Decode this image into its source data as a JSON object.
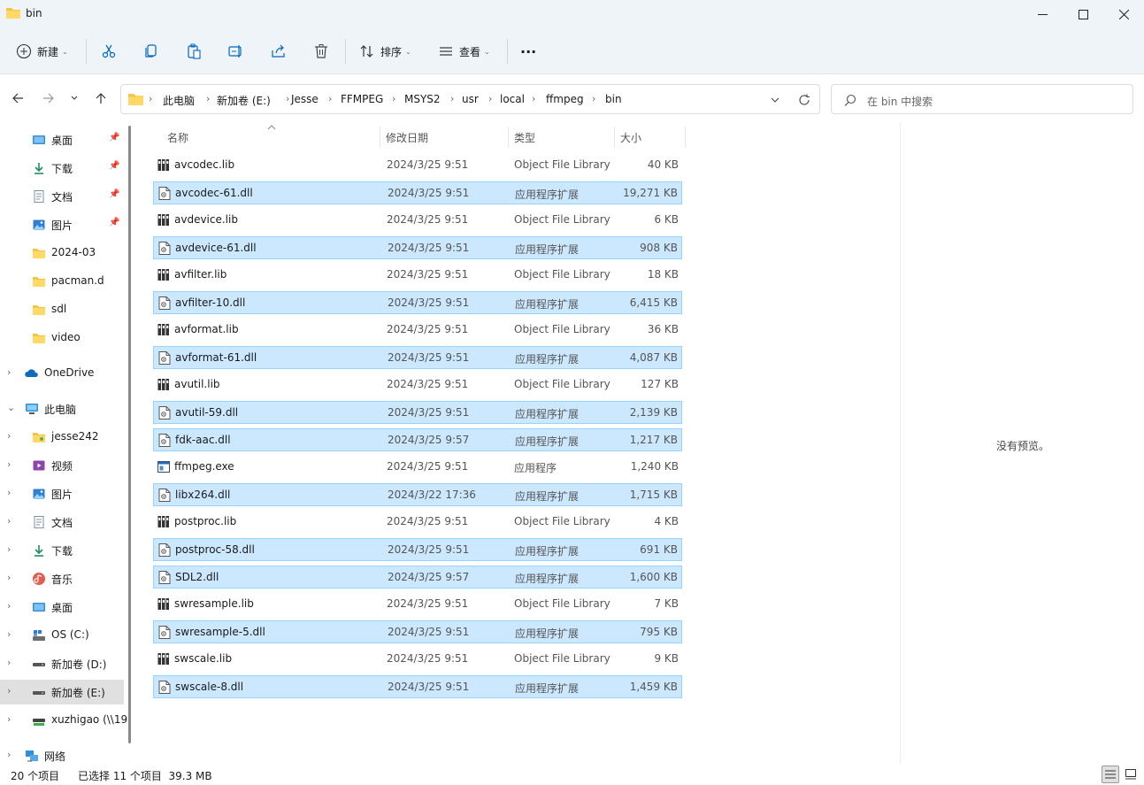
{
  "window": {
    "title": "bin",
    "minimize_label": "─",
    "maximize_label": "☐",
    "close_label": "✕"
  },
  "commandbar": {
    "new_label": "新建",
    "sort_label": "排序",
    "view_label": "查看",
    "more_label": "···"
  },
  "address": {
    "breadcrumbs": [
      "此电脑",
      "新加卷 (E:)",
      "Jesse",
      "FFMPEG",
      "MSYS2",
      "usr",
      "local",
      "ffmpeg",
      "bin"
    ],
    "separator": "›"
  },
  "search": {
    "placeholder": "在 bin 中搜索"
  },
  "nav": {
    "quick": [
      {
        "label": "桌面",
        "icon": "desktop-icon"
      },
      {
        "label": "下载",
        "icon": "download-icon"
      },
      {
        "label": "文档",
        "icon": "document-icon"
      },
      {
        "label": "图片",
        "icon": "picture-icon"
      },
      {
        "label": "2024-03",
        "icon": "folder-icon"
      },
      {
        "label": "pacman.d",
        "icon": "folder-icon"
      },
      {
        "label": "sdl",
        "icon": "folder-icon"
      },
      {
        "label": "video",
        "icon": "folder-icon"
      }
    ],
    "onedrive": "OneDrive",
    "thispc": "此电脑",
    "pc_items": [
      {
        "label": "jesse242",
        "icon": "user-folder-icon"
      },
      {
        "label": "视频",
        "icon": "video-icon"
      },
      {
        "label": "图片",
        "icon": "picture-icon"
      },
      {
        "label": "文档",
        "icon": "document-icon"
      },
      {
        "label": "下载",
        "icon": "download-icon"
      },
      {
        "label": "音乐",
        "icon": "music-icon"
      },
      {
        "label": "桌面",
        "icon": "desktop-icon"
      },
      {
        "label": "OS (C:)",
        "icon": "os-drive-icon"
      },
      {
        "label": "新加卷 (D:)",
        "icon": "drive-icon"
      },
      {
        "label": "新加卷 (E:)",
        "icon": "drive-icon"
      },
      {
        "label": "xuzhigao (\\\\19",
        "icon": "network-drive-icon"
      }
    ],
    "network": "网络"
  },
  "columns": {
    "name": "名称",
    "date": "修改日期",
    "type": "类型",
    "size": "大小"
  },
  "files": [
    {
      "name": "avcodec.lib",
      "date": "2024/3/25 9:51",
      "type": "Object File Library",
      "size": "40 KB",
      "kind": "lib",
      "selected": false
    },
    {
      "name": "avcodec-61.dll",
      "date": "2024/3/25 9:51",
      "type": "应用程序扩展",
      "size": "19,271 KB",
      "kind": "dll",
      "selected": true
    },
    {
      "name": "avdevice.lib",
      "date": "2024/3/25 9:51",
      "type": "Object File Library",
      "size": "6 KB",
      "kind": "lib",
      "selected": false
    },
    {
      "name": "avdevice-61.dll",
      "date": "2024/3/25 9:51",
      "type": "应用程序扩展",
      "size": "908 KB",
      "kind": "dll",
      "selected": true
    },
    {
      "name": "avfilter.lib",
      "date": "2024/3/25 9:51",
      "type": "Object File Library",
      "size": "18 KB",
      "kind": "lib",
      "selected": false
    },
    {
      "name": "avfilter-10.dll",
      "date": "2024/3/25 9:51",
      "type": "应用程序扩展",
      "size": "6,415 KB",
      "kind": "dll",
      "selected": true
    },
    {
      "name": "avformat.lib",
      "date": "2024/3/25 9:51",
      "type": "Object File Library",
      "size": "36 KB",
      "kind": "lib",
      "selected": false
    },
    {
      "name": "avformat-61.dll",
      "date": "2024/3/25 9:51",
      "type": "应用程序扩展",
      "size": "4,087 KB",
      "kind": "dll",
      "selected": true
    },
    {
      "name": "avutil.lib",
      "date": "2024/3/25 9:51",
      "type": "Object File Library",
      "size": "127 KB",
      "kind": "lib",
      "selected": false
    },
    {
      "name": "avutil-59.dll",
      "date": "2024/3/25 9:51",
      "type": "应用程序扩展",
      "size": "2,139 KB",
      "kind": "dll",
      "selected": true
    },
    {
      "name": "fdk-aac.dll",
      "date": "2024/3/25 9:57",
      "type": "应用程序扩展",
      "size": "1,217 KB",
      "kind": "dll",
      "selected": true
    },
    {
      "name": "ffmpeg.exe",
      "date": "2024/3/25 9:51",
      "type": "应用程序",
      "size": "1,240 KB",
      "kind": "exe",
      "selected": false
    },
    {
      "name": "libx264.dll",
      "date": "2024/3/22 17:36",
      "type": "应用程序扩展",
      "size": "1,715 KB",
      "kind": "dll",
      "selected": true
    },
    {
      "name": "postproc.lib",
      "date": "2024/3/25 9:51",
      "type": "Object File Library",
      "size": "4 KB",
      "kind": "lib",
      "selected": false
    },
    {
      "name": "postproc-58.dll",
      "date": "2024/3/25 9:51",
      "type": "应用程序扩展",
      "size": "691 KB",
      "kind": "dll",
      "selected": true
    },
    {
      "name": "SDL2.dll",
      "date": "2024/3/25 9:57",
      "type": "应用程序扩展",
      "size": "1,600 KB",
      "kind": "dll",
      "selected": true
    },
    {
      "name": "swresample.lib",
      "date": "2024/3/25 9:51",
      "type": "Object File Library",
      "size": "7 KB",
      "kind": "lib",
      "selected": false
    },
    {
      "name": "swresample-5.dll",
      "date": "2024/3/25 9:51",
      "type": "应用程序扩展",
      "size": "795 KB",
      "kind": "dll",
      "selected": true
    },
    {
      "name": "swscale.lib",
      "date": "2024/3/25 9:51",
      "type": "Object File Library",
      "size": "9 KB",
      "kind": "lib",
      "selected": false
    },
    {
      "name": "swscale-8.dll",
      "date": "2024/3/25 9:51",
      "type": "应用程序扩展",
      "size": "1,459 KB",
      "kind": "dll",
      "selected": true
    }
  ],
  "preview": {
    "message": "没有预览。"
  },
  "status": {
    "count": "20 个项目",
    "selected": "已选择 11 个项目  39.3 MB"
  },
  "colors": {
    "chrome_bg": "#eff4f9",
    "selection_bg": "#cce8ff",
    "selection_border": "#99d1ff",
    "folder_yellow": "#f5c542",
    "accent_blue": "#0067c0"
  }
}
